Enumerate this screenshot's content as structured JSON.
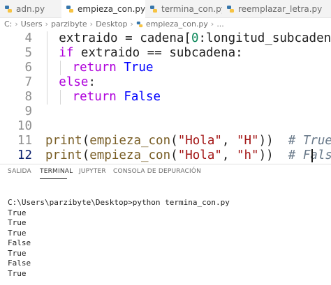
{
  "tabs": [
    {
      "label": "adn.py",
      "active": false,
      "closable": false
    },
    {
      "label": "empieza_con.py",
      "active": true,
      "closable": true
    },
    {
      "label": "termina_con.py",
      "active": false,
      "closable": false
    },
    {
      "label": "reemplazar_letra.py",
      "active": false,
      "closable": false
    }
  ],
  "breadcrumb": [
    "C:",
    "Users",
    "parzibyte",
    "Desktop",
    "empieza_con.py",
    "..."
  ],
  "editor": {
    "lines": [
      {
        "n": "4",
        "indent": 2,
        "tokens": [
          [
            "id",
            "extraido = cadena["
          ],
          [
            "num",
            "0"
          ],
          [
            "id",
            ":longitud_subcadena]"
          ]
        ]
      },
      {
        "n": "5",
        "indent": 2,
        "tokens": [
          [
            "kw",
            "if"
          ],
          [
            "id",
            " extraido == subcadena:"
          ]
        ]
      },
      {
        "n": "6",
        "indent": 3,
        "tokens": [
          [
            "kw",
            "return"
          ],
          [
            "id",
            " "
          ],
          [
            "bool",
            "True"
          ]
        ]
      },
      {
        "n": "7",
        "indent": 2,
        "tokens": [
          [
            "kw",
            "else"
          ],
          [
            "id",
            ":"
          ]
        ]
      },
      {
        "n": "8",
        "indent": 3,
        "tokens": [
          [
            "kw",
            "return"
          ],
          [
            "id",
            " "
          ],
          [
            "bool",
            "False"
          ]
        ]
      },
      {
        "n": "9",
        "indent": 0,
        "tokens": []
      },
      {
        "n": "10",
        "indent": 0,
        "tokens": []
      },
      {
        "n": "11",
        "indent": 0,
        "tokens": [
          [
            "fn",
            "print"
          ],
          [
            "id",
            "("
          ],
          [
            "fn",
            "empieza_con"
          ],
          [
            "id",
            "("
          ],
          [
            "str",
            "\"Hola\""
          ],
          [
            "id",
            ", "
          ],
          [
            "str",
            "\"H\""
          ],
          [
            "id",
            "))  "
          ],
          [
            "cm",
            "# True"
          ]
        ]
      },
      {
        "n": "12",
        "indent": 0,
        "active": true,
        "tokens": [
          [
            "fn",
            "print"
          ],
          [
            "id",
            "("
          ],
          [
            "fn",
            "empieza_con"
          ],
          [
            "id",
            "("
          ],
          [
            "str",
            "\"Hola\""
          ],
          [
            "id",
            ", "
          ],
          [
            "str",
            "\"h\""
          ],
          [
            "id",
            "))  "
          ],
          [
            "cm",
            "# False"
          ]
        ]
      }
    ]
  },
  "panel": {
    "tabs": [
      {
        "label": "SALIDA",
        "active": false
      },
      {
        "label": "TERMINAL",
        "active": true
      },
      {
        "label": "JUPYTER",
        "active": false
      },
      {
        "label": "CONSOLA DE DEPURACIÓN",
        "active": false
      }
    ]
  },
  "terminal": {
    "lines": [
      "C:\\Users\\parzibyte\\Desktop>python termina_con.py",
      "True",
      "True",
      "True",
      "False",
      "True",
      "False",
      "True"
    ]
  },
  "colors": {
    "keyword": "#af00db",
    "function": "#795e26",
    "string": "#a31515",
    "number": "#098658",
    "comment": "#6a7a8a",
    "boolean": "#0000ff"
  }
}
